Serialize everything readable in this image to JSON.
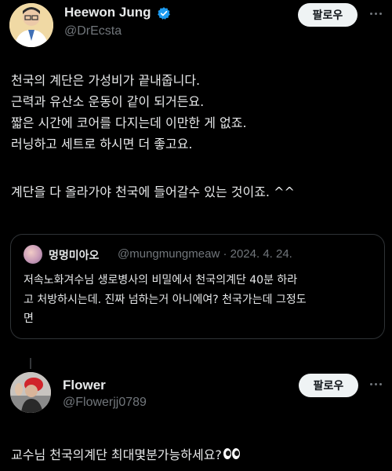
{
  "tweet": {
    "author_name": "Heewon Jung",
    "author_handle": "@DrEcsta",
    "follow_label": "팔로우",
    "verified_color": "#1d9bf0",
    "body_lines": [
      "천국의 계단은 가성비가 끝내줍니다.",
      "근력과 유산소 운동이 같이 되거든요.",
      "짧은 시간에 코어를 다지는데 이만한 게 없죠.",
      "러닝하고 세트로 하시면 더 좋고요.",
      "계단을 다 올라가야 천국에 들어갈수 있는 것이죠. ^^"
    ]
  },
  "quote": {
    "author_name": "멍멍미아오",
    "meta": "@mungmungmeaw · 2024. 4. 24.",
    "lines": [
      "저속노화겨수님 생로병사의 비밀에서 천국의계단 40분 하라",
      "고 처방하시는데. 진짜 넘하는거 아니에여? 천국가는데 그정도",
      "면"
    ]
  },
  "reply": {
    "author_name": "Flower",
    "author_handle": "@Flowerjj0789",
    "follow_label": "팔로우",
    "text": "교수님 천국의계단 최대몇분가능하세요?"
  }
}
